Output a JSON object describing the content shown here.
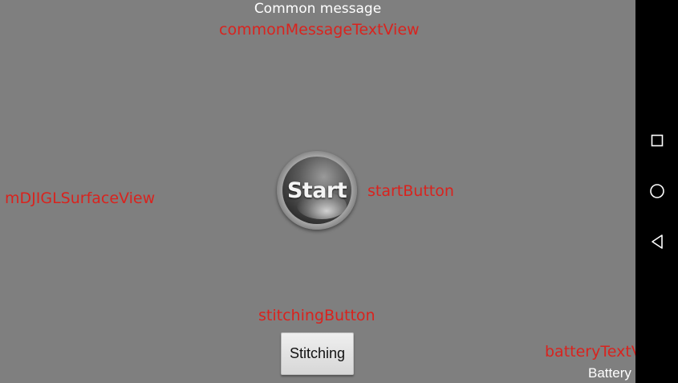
{
  "common_message": {
    "text": "Common message",
    "debug_label": "commonMessageTextView"
  },
  "surface": {
    "debug_label": "mDJIGLSurfaceView"
  },
  "start_button": {
    "text": "Start",
    "debug_label": "startButton"
  },
  "stitching_button": {
    "text": "Stitching",
    "debug_label": "stitchingButton"
  },
  "battery": {
    "text": "Battery",
    "debug_label": "batteryTextView"
  },
  "nav_bar": {
    "icons": [
      "recent-apps-icon",
      "home-icon",
      "back-icon"
    ]
  },
  "colors": {
    "background": "#7f7f7f",
    "debug_label": "#d9231e",
    "nav_bar": "#000000",
    "text": "#ffffff"
  }
}
